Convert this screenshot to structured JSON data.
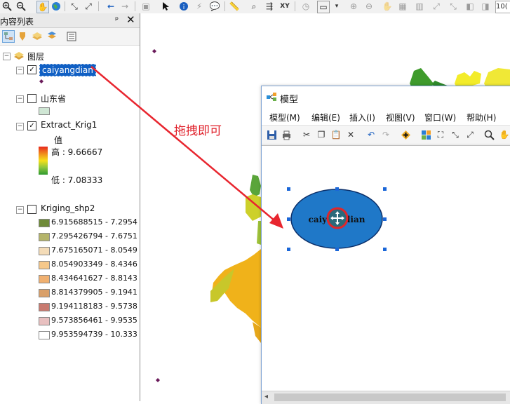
{
  "toc": {
    "title": "内容列表",
    "pin": "ᵖ",
    "close": "✕",
    "root_label": "图层",
    "layers": [
      {
        "name": "caiyangdian",
        "checked": true,
        "selected": true
      },
      {
        "name": "山东省",
        "checked": false
      },
      {
        "name": "Extract_Krig1",
        "checked": true,
        "field": "值",
        "high": "高 : 9.66667",
        "low": "低 : 7.08333"
      },
      {
        "name": "Kriging_shp2",
        "checked": false
      }
    ],
    "kriging_classes": [
      {
        "label": "6.915688515 - 7.2954",
        "color": "#6e8a38"
      },
      {
        "label": "7.295426794 - 7.6751",
        "color": "#b4b46a"
      },
      {
        "label": "7.675165071 - 8.0549",
        "color": "#f4dcb8"
      },
      {
        "label": "8.054903349 - 8.4346",
        "color": "#f6c88a"
      },
      {
        "label": "8.434641627 - 8.8143",
        "color": "#f0b070"
      },
      {
        "label": "8.814379905 - 9.1941",
        "color": "#d9a06a"
      },
      {
        "label": "9.194118183 - 9.5738",
        "color": "#c87a70"
      },
      {
        "label": "9.573856461 - 9.9535",
        "color": "#e8c0c0"
      },
      {
        "label": "9.953594739 - 10.333",
        "color": "#ffffff"
      }
    ],
    "shandong_swatch_color": "#cfe6d4"
  },
  "annotation": "拖拽即可",
  "model": {
    "title": "模型",
    "menus": [
      "模型(M)",
      "编辑(E)",
      "插入(I)",
      "视图(V)",
      "窗口(W)",
      "帮助(H)"
    ],
    "node_label": "caiyangdian",
    "node_color": "#1f78c8"
  },
  "toolbar": {
    "xy_label": "XY",
    "scale_fragment": "10("
  },
  "colors": {
    "arrow": "#e8262f",
    "selection": "#1160c4"
  }
}
